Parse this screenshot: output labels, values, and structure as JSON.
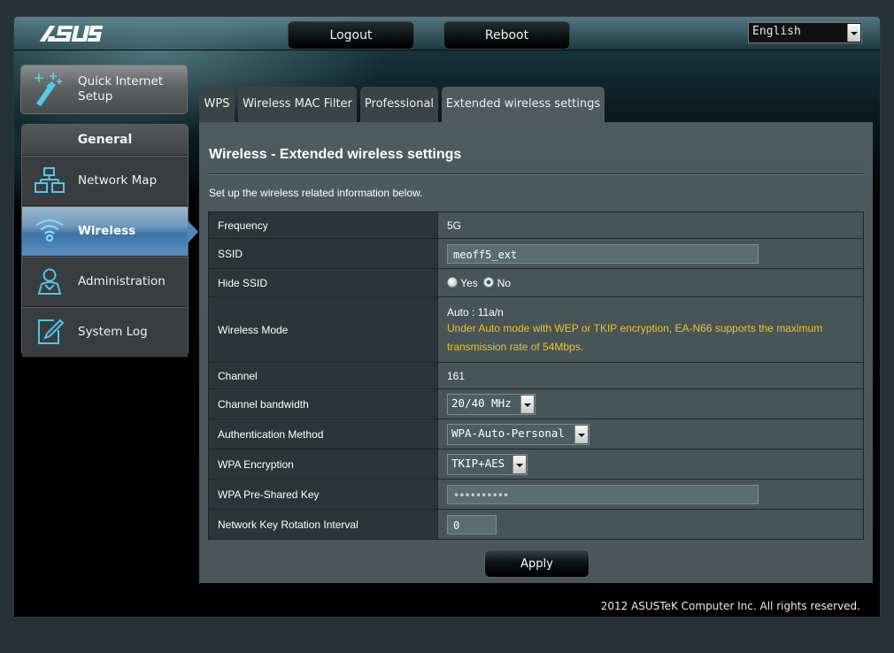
{
  "header": {
    "logo": "/ISUS",
    "logout_label": "Logout",
    "reboot_label": "Reboot",
    "language": "English"
  },
  "quick_setup": {
    "label_line1": "Quick Internet",
    "label_line2": "Setup",
    "icon": "magic-wand-icon"
  },
  "sidebar": {
    "heading": "General",
    "items": [
      {
        "label": "Network Map",
        "icon": "network-map-icon",
        "active": false
      },
      {
        "label": "Wireless",
        "icon": "wifi-icon",
        "active": true
      },
      {
        "label": "Administration",
        "icon": "user-icon",
        "active": false
      },
      {
        "label": "System Log",
        "icon": "edit-log-icon",
        "active": false
      }
    ]
  },
  "tabs": [
    {
      "label": "WPS",
      "active": false
    },
    {
      "label": "Wireless MAC Filter",
      "active": false
    },
    {
      "label": "Professional",
      "active": false
    },
    {
      "label": "Extended wireless settings",
      "active": true
    }
  ],
  "main": {
    "title": "Wireless - Extended wireless settings",
    "description": "Set up the wireless related information below.",
    "rows": {
      "frequency": {
        "label": "Frequency",
        "value": "5G"
      },
      "ssid": {
        "label": "SSID",
        "value": "meoff5_ext"
      },
      "hide_ssid": {
        "label": "Hide SSID",
        "options": [
          "Yes",
          "No"
        ],
        "selected": "No"
      },
      "wireless_mode": {
        "label": "Wireless Mode",
        "value": "Auto : 11a/n",
        "note": "Under Auto mode with WEP or TKIP encryption, EA-N66 supports the maximum transmission rate of 54Mbps."
      },
      "channel": {
        "label": "Channel",
        "value": "161"
      },
      "channel_bandwidth": {
        "label": "Channel bandwidth",
        "value": "20/40 MHz"
      },
      "auth_method": {
        "label": "Authentication Method",
        "value": "WPA-Auto-Personal"
      },
      "wpa_encryption": {
        "label": "WPA Encryption",
        "value": "TKIP+AES"
      },
      "wpa_psk": {
        "label": "WPA Pre-Shared Key",
        "value": "••••••••••"
      },
      "key_rotation": {
        "label": "Network Key Rotation Interval",
        "value": "0"
      }
    },
    "apply_label": "Apply"
  },
  "footer": {
    "copyright": "2012 ASUSTeK Computer Inc. All rights reserved."
  },
  "colors": {
    "warning_text": "#f0c419",
    "active_nav": "#4f87bb",
    "content_bg": "#4d5b5f"
  }
}
